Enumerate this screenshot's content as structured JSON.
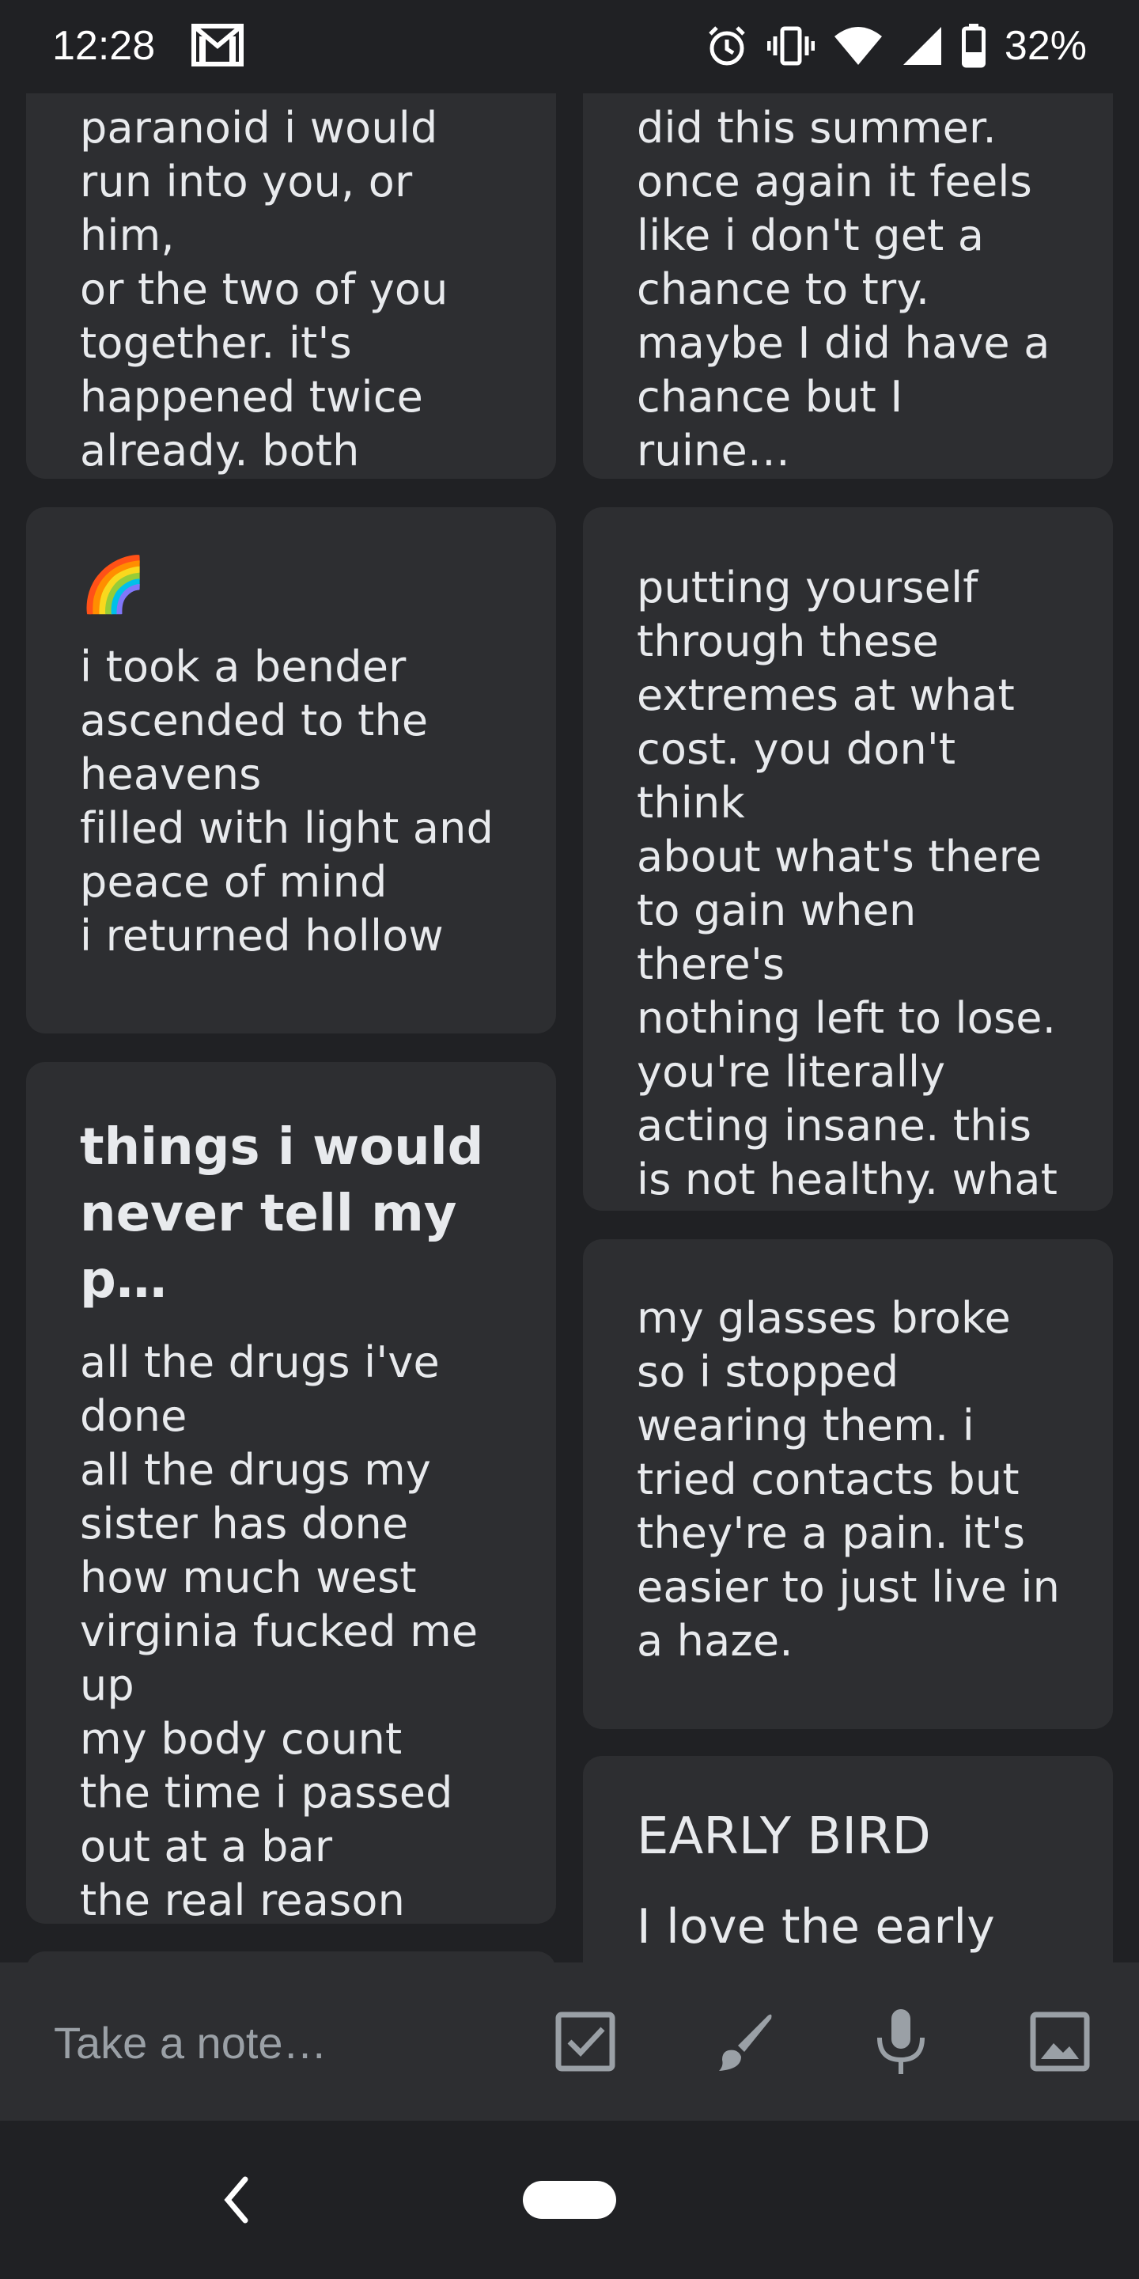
{
  "status_bar": {
    "time": "12:28",
    "battery_percent": "32%",
    "icons": [
      "gmail-icon",
      "alarm-icon",
      "vibrate-icon",
      "wifi-icon",
      "signal-icon",
      "battery-icon"
    ]
  },
  "notes": {
    "left": [
      {
        "title": "",
        "emoji": "",
        "text": "paranoid i would\nrun into you, or him,\nor the two of you\ntogether. it's\nhappened twice\nalready. both time…"
      },
      {
        "title": "",
        "emoji": "🌈",
        "text": "i took a bender\nascended to the\nheavens\nfilled with light and\npeace of mind\ni returned hollow"
      },
      {
        "title": "things i would\nnever tell my p…",
        "emoji": "",
        "text": "all the drugs i've\ndone\nall the drugs my\nsister has done\nhow much west\nvirginia fucked me\nup\nmy body count\nthe time i passed\nout at a bar\nthe real reason i'm…"
      }
    ],
    "right": [
      {
        "title": "",
        "emoji": "",
        "text": "did this summer.\nonce again it feels\nlike i don't get a\nchance to try.\nmaybe I did have a\nchance but I ruine…"
      },
      {
        "title": "",
        "emoji": "",
        "text": "putting yourself\nthrough these\nextremes at what\ncost. you don't think\nabout what's there\nto gain when there's\nnothing left to lose.\nyou're literally\nacting insane. this\nis not healthy. what\nwould your mothe…"
      },
      {
        "title": "",
        "emoji": "",
        "text": "my glasses broke\nso i stopped\nwearing them. i\ntried contacts but\nthey're a pain. it's\neasier to just live in\na haze."
      },
      {
        "title": "EARLY BIRD",
        "emoji": "",
        "text": "I love the early"
      }
    ]
  },
  "take_note_bar": {
    "placeholder": "Take a note…",
    "actions": [
      "checkbox-icon",
      "brush-icon",
      "mic-icon",
      "image-icon"
    ]
  },
  "colors": {
    "background": "#202124",
    "card": "#2d2e31",
    "text": "#e8eaed",
    "muted": "#9aa0a6"
  }
}
